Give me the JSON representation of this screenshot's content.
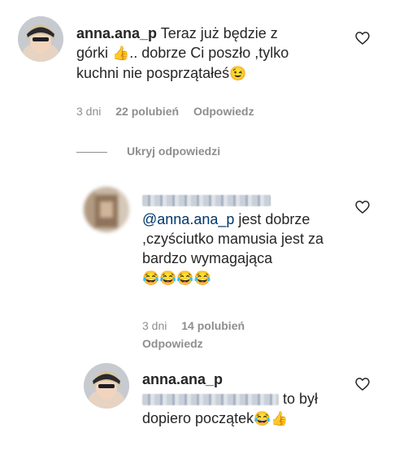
{
  "comments": [
    {
      "username": "anna.ana_p",
      "text": "Teraz już będzie z górki",
      "emoji1": "👍",
      "text2": ".. dobrze Ci poszło ,tylko kuchni nie posprzątałeś",
      "emoji2": "😉",
      "time": "3 dni",
      "likes": "22 polubień",
      "reply": "Odpowiedz"
    }
  ],
  "hide_replies": "Ukryj odpowiedzi",
  "replies": [
    {
      "mention": "@anna.ana_p",
      "text": " jest dobrze ,czyściutko mamusia jest za bardzo wymagająca",
      "emojis": "😂😂😂😂",
      "time": "3 dni",
      "likes": "14 polubień",
      "reply": "Odpowiedz"
    },
    {
      "username": "anna.ana_p",
      "text": " to był dopiero początek",
      "emojis": "😂👍"
    }
  ],
  "icons": {
    "like": "heart-outline-icon"
  }
}
